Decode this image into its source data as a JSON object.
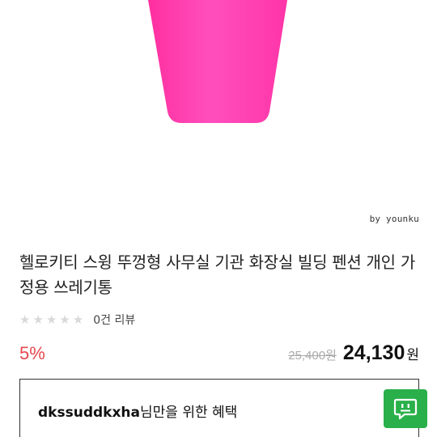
{
  "product": {
    "watermark": "by younku",
    "title": "헬로키티 스윙 뚜껑형 사무실 기관 화장실 빌딩 펜션 개인 가정용 쓰레기통",
    "image_color": "#ff3fb4"
  },
  "reviews": {
    "rating": 0,
    "max_rating": 5,
    "summary": "0건 리뷰"
  },
  "pricing": {
    "discount": "5%",
    "original_price": "25,400원",
    "sale_price": "24,130",
    "currency": "원"
  },
  "benefit": {
    "username": "dkssuddkxha",
    "suffix": "님만을 위한 혜택"
  },
  "chat": {
    "icon": "chat-bubble-icon",
    "color": "#2ab04a"
  }
}
